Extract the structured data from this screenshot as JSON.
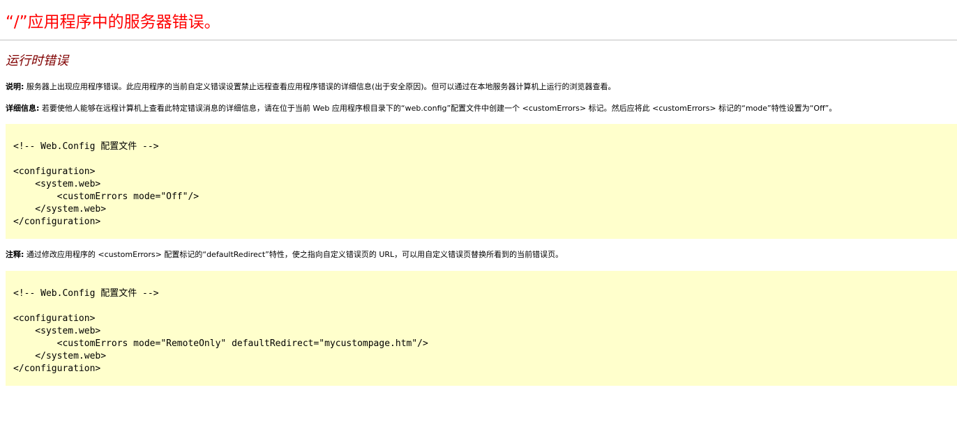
{
  "page": {
    "title": "“/”应用程序中的服务器错误。",
    "subtitle": "运行时错误"
  },
  "description": {
    "label": "说明:",
    "text": " 服务器上出现应用程序错误。此应用程序的当前自定义错误设置禁止远程查看应用程序错误的详细信息(出于安全原因)。但可以通过在本地服务器计算机上运行的浏览器查看。"
  },
  "details": {
    "label": "详细信息:",
    "text": " 若要使他人能够在远程计算机上查看此特定错误消息的详细信息，请在位于当前 Web 应用程序根目录下的“web.config”配置文件中创建一个 <customErrors> 标记。然后应将此 <customErrors> 标记的“mode”特性设置为“Off”。"
  },
  "code_sample_1": "<!-- Web.Config 配置文件 -->\n\n<configuration>\n    <system.web>\n        <customErrors mode=\"Off\"/>\n    </system.web>\n</configuration>",
  "note": {
    "label": "注释:",
    "text": " 通过修改应用程序的 <customErrors> 配置标记的“defaultRedirect”特性，使之指向自定义错误页的 URL，可以用自定义错误页替换所看到的当前错误页。"
  },
  "code_sample_2": "<!-- Web.Config 配置文件 -->\n\n<configuration>\n    <system.web>\n        <customErrors mode=\"RemoteOnly\" defaultRedirect=\"mycustompage.htm\"/>\n    </system.web>\n</configuration>",
  "colors": {
    "title": "#ff0000",
    "subtitle": "#800000",
    "code_background": "#ffffcc",
    "divider": "#c0c0c0"
  }
}
